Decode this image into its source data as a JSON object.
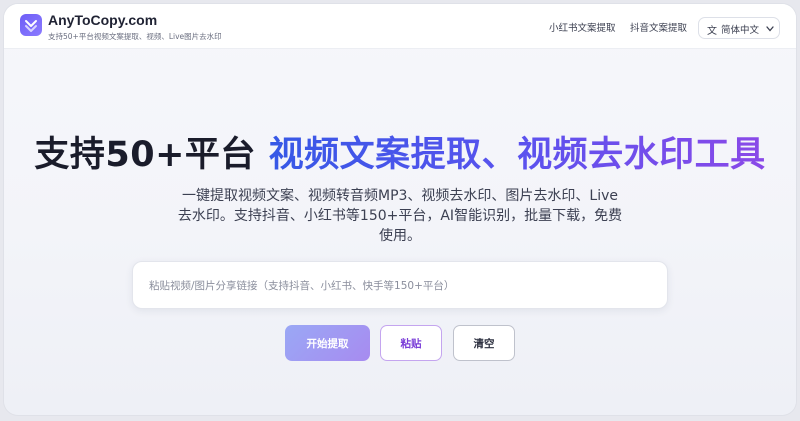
{
  "header": {
    "brand_name": "AnyToCopy.com",
    "brand_tagline": "支持50+平台视频文案提取、视频、Live图片去水印",
    "nav": [
      {
        "label": "小红书文案提取"
      },
      {
        "label": "抖音文案提取"
      }
    ],
    "language": {
      "icon": "translate-icon",
      "label": "简体中文"
    }
  },
  "hero": {
    "title_part1": "支持50+平台",
    "title_part2": "视频文案提取、视频去水印工具",
    "subtitle": "一键提取视频文案、视频转音频MP3、视频去水印、图片去水印、Live去水印。支持抖音、小红书等150+平台，AI智能识别，批量下载，免费使用。"
  },
  "search": {
    "value": "",
    "placeholder": "粘贴视频/图片分享链接（支持抖音、小红书、快手等150+平台）"
  },
  "actions": {
    "start_label": "开始提取",
    "paste_label": "粘贴",
    "clear_label": "清空"
  },
  "colors": {
    "accent_purple": "#7b3fd8",
    "title_gradient_start": "#3658e6",
    "title_gradient_end": "#8a49e8",
    "start_button_start": "#9aa8f5",
    "start_button_end": "#a78bf0"
  }
}
